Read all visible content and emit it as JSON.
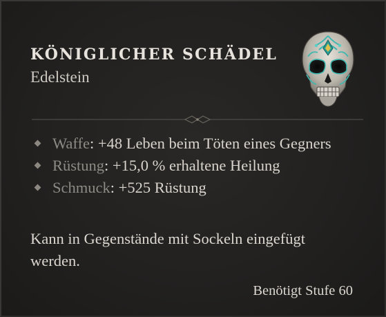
{
  "item": {
    "name": "KÖNIGLICHER SCHÄDEL",
    "type": "Edelstein",
    "icon": "royal-skull-gem-icon"
  },
  "affixes": [
    {
      "slot": "Waffe",
      "separator": ": ",
      "effect": "+48 Leben beim Töten eines Gegners"
    },
    {
      "slot": "Rüstung",
      "separator": ": ",
      "effect": "+15,0 % erhaltene Heilung"
    },
    {
      "slot": "Schmuck",
      "separator": ": ",
      "effect": "+525 Rüstung"
    }
  ],
  "description": "Kann in Gegenstände mit Sockeln eingefügt werden.",
  "requirement": "Benötigt Stufe 60",
  "colors": {
    "background": "#232120",
    "text": "#d9d4cd",
    "slot_label": "#8e8a85",
    "gem_accent": "#3fb8b0"
  }
}
